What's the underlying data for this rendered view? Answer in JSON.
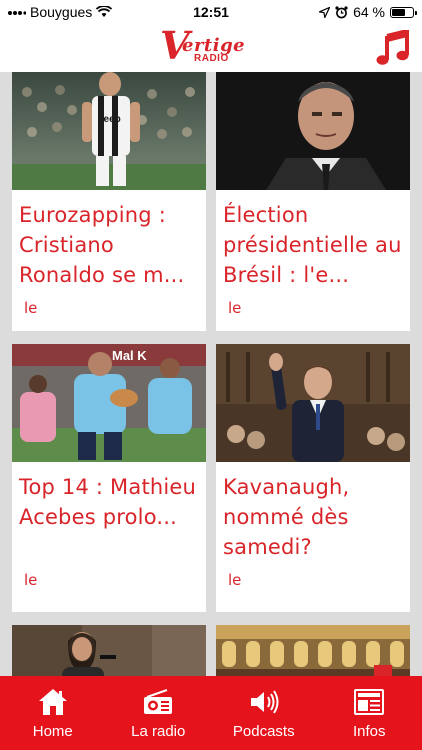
{
  "status_bar": {
    "carrier": "Bouygues",
    "time": "12:51",
    "battery_percent": "64 %",
    "battery_level": 0.64
  },
  "header": {
    "logo_letter": "V",
    "logo_word": "ertige",
    "logo_sub": "RADIO",
    "music_icon": "music-note-icon"
  },
  "articles": [
    {
      "title": "Eurozapping : Cristiano Ronaldo se m...",
      "meta": "le",
      "image": "football-player-photo"
    },
    {
      "title": "Élection présidentielle au Brésil : l'e...",
      "meta": "le",
      "image": "politician-portrait-photo"
    },
    {
      "title": "Top 14 : Mathieu Acebes prolo...",
      "meta": "le",
      "image": "rugby-match-photo"
    },
    {
      "title": "Kavanaugh, nommé dès samedi?",
      "meta": "le",
      "image": "senate-hearing-photo"
    },
    {
      "title": "",
      "meta": "",
      "image": "woman-speaking-photo"
    },
    {
      "title": "",
      "meta": "",
      "image": "parliament-chamber-photo"
    }
  ],
  "bottom_nav": {
    "items": [
      {
        "label": "Home",
        "icon": "home-icon"
      },
      {
        "label": "La radio",
        "icon": "radio-icon"
      },
      {
        "label": "Podcasts",
        "icon": "speaker-icon"
      },
      {
        "label": "Infos",
        "icon": "newspaper-icon"
      }
    ]
  },
  "colors": {
    "accent": "#d9252a",
    "nav_background": "#e5131c",
    "feed_background": "#dcdcdc"
  }
}
